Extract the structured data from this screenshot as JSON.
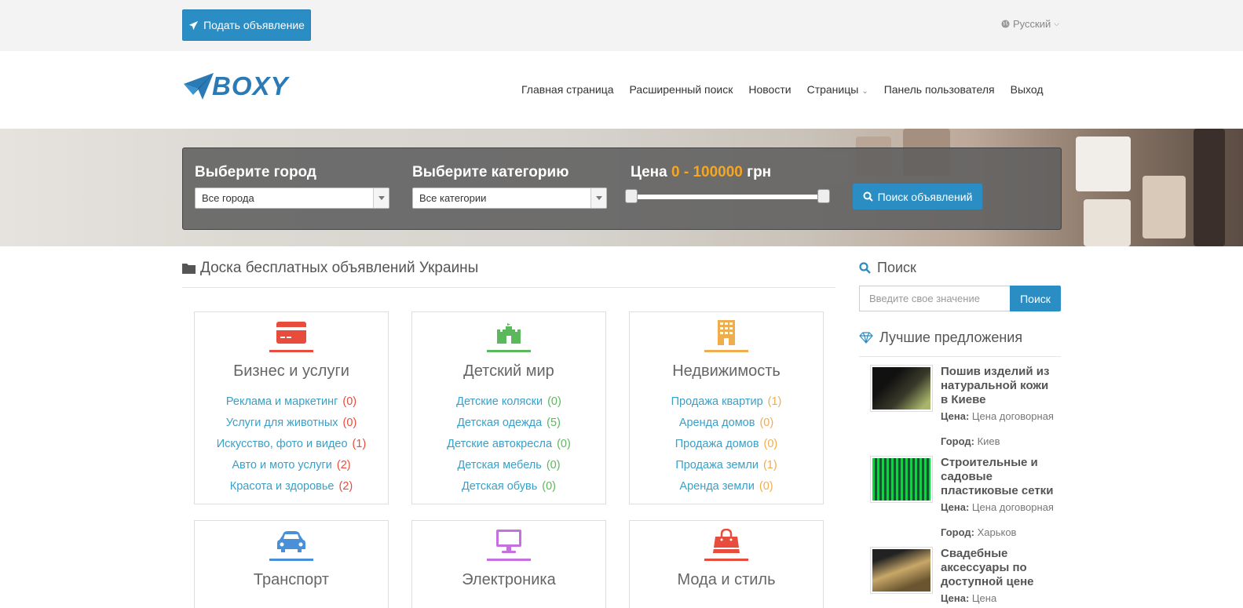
{
  "topbar": {
    "post_button": "Подать объявление",
    "language": "Русский"
  },
  "header": {
    "logo": "BOXY",
    "nav": [
      "Главная страница",
      "Расширенный поиск",
      "Новости",
      "Страницы",
      "Панель пользователя",
      "Выход"
    ]
  },
  "search": {
    "city_label": "Выберите город",
    "city_value": "Все города",
    "category_label": "Выберите категорию",
    "category_value": "Все категории",
    "price_label": "Цена",
    "price_range": "0 - 100000",
    "price_currency": "грн",
    "price_min": 0,
    "price_max": 100000,
    "button": "Поиск объявлений"
  },
  "main": {
    "title": "Доска бесплатных объявлений Украины",
    "categories": [
      {
        "title": "Бизнес и услуги",
        "color": "#e74c3c",
        "icon": "credit-card-icon",
        "items": [
          [
            "Реклама и маркетинг",
            "(0)"
          ],
          [
            "Услуги для животных",
            "(0)"
          ],
          [
            "Искусство, фото и видео",
            "(1)"
          ],
          [
            "Авто и мото услуги",
            "(2)"
          ],
          [
            "Красота и здоровье",
            "(2)"
          ]
        ]
      },
      {
        "title": "Детский мир",
        "color": "#5cb85c",
        "icon": "castle-icon",
        "items": [
          [
            "Детские коляски",
            "(0)"
          ],
          [
            "Детская одежда",
            "(5)"
          ],
          [
            "Детские автокресла",
            "(0)"
          ],
          [
            "Детская мебель",
            "(0)"
          ],
          [
            "Детская обувь",
            "(0)"
          ]
        ]
      },
      {
        "title": "Недвижимость",
        "color": "#f0ad4e",
        "icon": "building-icon",
        "items": [
          [
            "Продажа квартир",
            "(1)"
          ],
          [
            "Аренда домов",
            "(0)"
          ],
          [
            "Продажа домов",
            "(0)"
          ],
          [
            "Продажа земли",
            "(1)"
          ],
          [
            "Аренда земли",
            "(0)"
          ]
        ]
      },
      {
        "title": "Транспорт",
        "color": "#4a90d9",
        "icon": "car-icon",
        "items": []
      },
      {
        "title": "Электроника",
        "color": "#c56fe0",
        "icon": "monitor-icon",
        "items": []
      },
      {
        "title": "Мода и стиль",
        "color": "#e74c3c",
        "icon": "shopping-bag-icon",
        "items": []
      }
    ]
  },
  "sidebar": {
    "search_title": "Поиск",
    "search_placeholder": "Введите свое значение",
    "search_button": "Поиск",
    "offers_title": "Лучшие предложения",
    "price_key": "Цена:",
    "city_key": "Город:",
    "offers": [
      {
        "title": "Пошив изделий из натуральной кожи в Киеве",
        "price": "Цена договорная",
        "city": "Киев"
      },
      {
        "title": "Строительные и садовые пластиковые сетки",
        "price": "Цена договорная",
        "city": "Харьков"
      },
      {
        "title": "Свадебные аксессуары по доступной цене",
        "price": "Цена"
      }
    ]
  }
}
